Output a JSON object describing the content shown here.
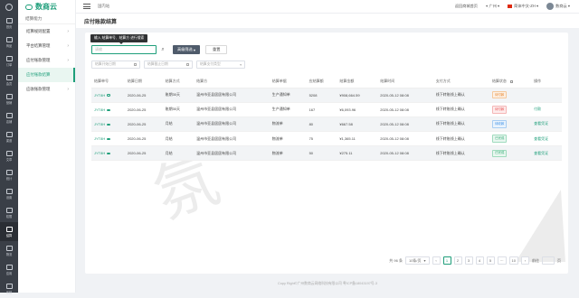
{
  "brand": {
    "name": "数商云"
  },
  "rail": [
    {
      "label": "首页",
      "icon": "home-icon"
    },
    {
      "label": "商品",
      "icon": "goods-icon"
    },
    {
      "label": "订单",
      "icon": "order-icon"
    },
    {
      "label": "会员",
      "icon": "member-icon"
    },
    {
      "label": "营销",
      "icon": "marketing-icon"
    },
    {
      "label": "店铺",
      "icon": "store-icon"
    },
    {
      "label": "渠道",
      "icon": "channel-icon"
    },
    {
      "label": "文章",
      "icon": "article-icon"
    },
    {
      "label": "统计",
      "icon": "stats-icon"
    },
    {
      "label": "设置",
      "icon": "settings-icon"
    },
    {
      "label": "权限",
      "icon": "permission-icon"
    },
    {
      "label": "结算",
      "icon": "settle-icon"
    },
    {
      "label": "物流",
      "icon": "logistics-icon"
    },
    {
      "label": "应用",
      "icon": "app-icon"
    },
    {
      "label": "系统",
      "icon": "system-icon"
    }
  ],
  "sidebar": {
    "title": "结算能力",
    "items": [
      {
        "label": "结算规则配置",
        "active": false
      },
      {
        "label": "平台结算管理",
        "active": false
      },
      {
        "label": "应付账款管理",
        "active": false
      },
      {
        "label": "应付账款结算",
        "active": true
      },
      {
        "label": "应收账款管理",
        "active": false
      }
    ]
  },
  "header": {
    "crumb": "国内站",
    "links": [
      "返回商城首页",
      "广州",
      "简体中文-ZH",
      "数商云"
    ]
  },
  "page": {
    "title": "应付账款结算"
  },
  "search": {
    "tooltip": "输入 结算单号、结算方 进行搜索",
    "placeholder": "请输",
    "adv_label": "高级筛选",
    "reset_label": "重置"
  },
  "filters": [
    "结算开始日期",
    "结算截止日期",
    "结算支付类型"
  ],
  "table": {
    "columns": [
      "结算单号",
      "结算日期",
      "结算方式",
      "结算方",
      "结算单据",
      "应结算额",
      "结算金额",
      "结算时间",
      "支付方式",
      "结算状态",
      "操作"
    ],
    "rows": [
      {
        "code": "JYT8H",
        "date": "2020-06-25",
        "method": "账期30天",
        "party": "温州市亚县居居有限公司",
        "doc": "生产通知单",
        "amount": "5208",
        "money": "¥908,664.59",
        "time": "2020-05-12 08:08",
        "pay": "线下转账线上确认",
        "status": "待付款",
        "status_color": "orange",
        "op": ""
      },
      {
        "code": "JYT8H",
        "date": "2020-06-25",
        "method": "账期30天",
        "party": "温州市亚县居居有限公司",
        "doc": "生产通知单",
        "amount": "167",
        "money": "¥6,093.96",
        "time": "2020-05-12 08:08",
        "pay": "线下转账线上确认",
        "status": "待付款",
        "status_color": "red",
        "op": "付款"
      },
      {
        "code": "JYT8H",
        "date": "2020-06-25",
        "method": "月结",
        "party": "温州市亚县居居有限公司",
        "doc": "物流单",
        "amount": "80",
        "money": "¥667.58",
        "time": "2020-05-12 08:08",
        "pay": "线下转账线上确认",
        "status": "待收款",
        "status_color": "blue",
        "op": "查看凭证"
      },
      {
        "code": "JYT8H",
        "date": "2020-06-25",
        "method": "月结",
        "party": "温州市亚县居居有限公司",
        "doc": "物流单",
        "amount": "75",
        "money": "¥1,365.11",
        "time": "2020-05-12 08:08",
        "pay": "线下转账线上确认",
        "status": "已完成",
        "status_color": "green",
        "op": "查看凭证"
      },
      {
        "code": "JYT8H",
        "date": "2020-06-25",
        "method": "月结",
        "party": "温州市亚县居居有限公司",
        "doc": "物流单",
        "amount": "50",
        "money": "¥275.11",
        "time": "2020-05-12 08:08",
        "pay": "线下转账线上确认",
        "status": "已完成",
        "status_color": "green",
        "op": "查看凭证"
      }
    ]
  },
  "pager": {
    "total": "共 96 条",
    "pages": [
      "1",
      "2",
      "3",
      "4",
      "5",
      "···",
      "10"
    ],
    "current": "1",
    "size": "10条/页",
    "goto": "前往",
    "unit": "页"
  },
  "footer": "Copy Right©广州数商云网络科技有限公司 粤ICP备18043197号-3",
  "colors": {
    "accent": "#1e9e7a",
    "rail_bg": "#3a3f47",
    "adv_btn": "#4f5b6b"
  }
}
